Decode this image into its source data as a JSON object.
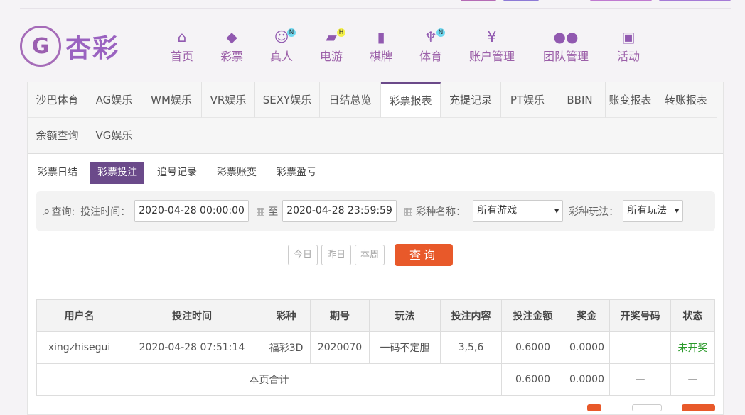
{
  "brand": {
    "logo_text": "杏彩"
  },
  "nav": [
    {
      "label": "首页",
      "icon": "home-icon"
    },
    {
      "label": "彩票",
      "icon": "lottery-ticket-icon"
    },
    {
      "label": "真人",
      "icon": "live-dealer-icon",
      "badge": "N"
    },
    {
      "label": "电游",
      "icon": "gamepad-icon",
      "badge": "H"
    },
    {
      "label": "棋牌",
      "icon": "cards-icon"
    },
    {
      "label": "体育",
      "icon": "trophy-icon",
      "badge": "N"
    },
    {
      "label": "账户管理",
      "icon": "yen-coin-icon"
    },
    {
      "label": "团队管理",
      "icon": "team-icon"
    },
    {
      "label": "活动",
      "icon": "gift-icon"
    }
  ],
  "tabs": [
    "沙巴体育",
    "AG娱乐",
    "WM娱乐",
    "VR娱乐",
    "SEXY娱乐",
    "日结总览",
    "彩票报表",
    "充提记录",
    "PT娱乐",
    "BBIN",
    "账变报表",
    "转账报表",
    "余额查询",
    "VG娱乐"
  ],
  "subtabs": [
    "彩票日结",
    "彩票投注",
    "追号记录",
    "彩票账变",
    "彩票盈亏"
  ],
  "filter": {
    "query_label": "查询:",
    "time_label": "投注时间：",
    "start": "2020-04-28 00:00:00",
    "to": "至",
    "end": "2020-04-28 23:59:59",
    "game_label": "彩种名称：",
    "game_value": "所有游戏",
    "play_label": "彩种玩法：",
    "play_value": "所有玩法"
  },
  "quick": {
    "today": "今日",
    "yesterday": "昨日",
    "week": "本周",
    "search": "查询"
  },
  "table": {
    "headers": [
      "用户名",
      "投注时间",
      "彩种",
      "期号",
      "玩法",
      "投注内容",
      "投注金额",
      "奖金",
      "开奖号码",
      "状态"
    ],
    "row": [
      "xingzhisegui",
      "2020-04-28 07:51:14",
      "福彩3D",
      "2020070",
      "一码不定胆",
      "3,5,6",
      "0.6000",
      "0.0000",
      "",
      "未开奖"
    ],
    "total": {
      "label": "本页合计",
      "amount": "0.6000",
      "bonus": "0.0000",
      "numbers": "—",
      "status": "—"
    }
  },
  "colors": {
    "accent": "#6b4a8a",
    "button": "#e8592a"
  }
}
